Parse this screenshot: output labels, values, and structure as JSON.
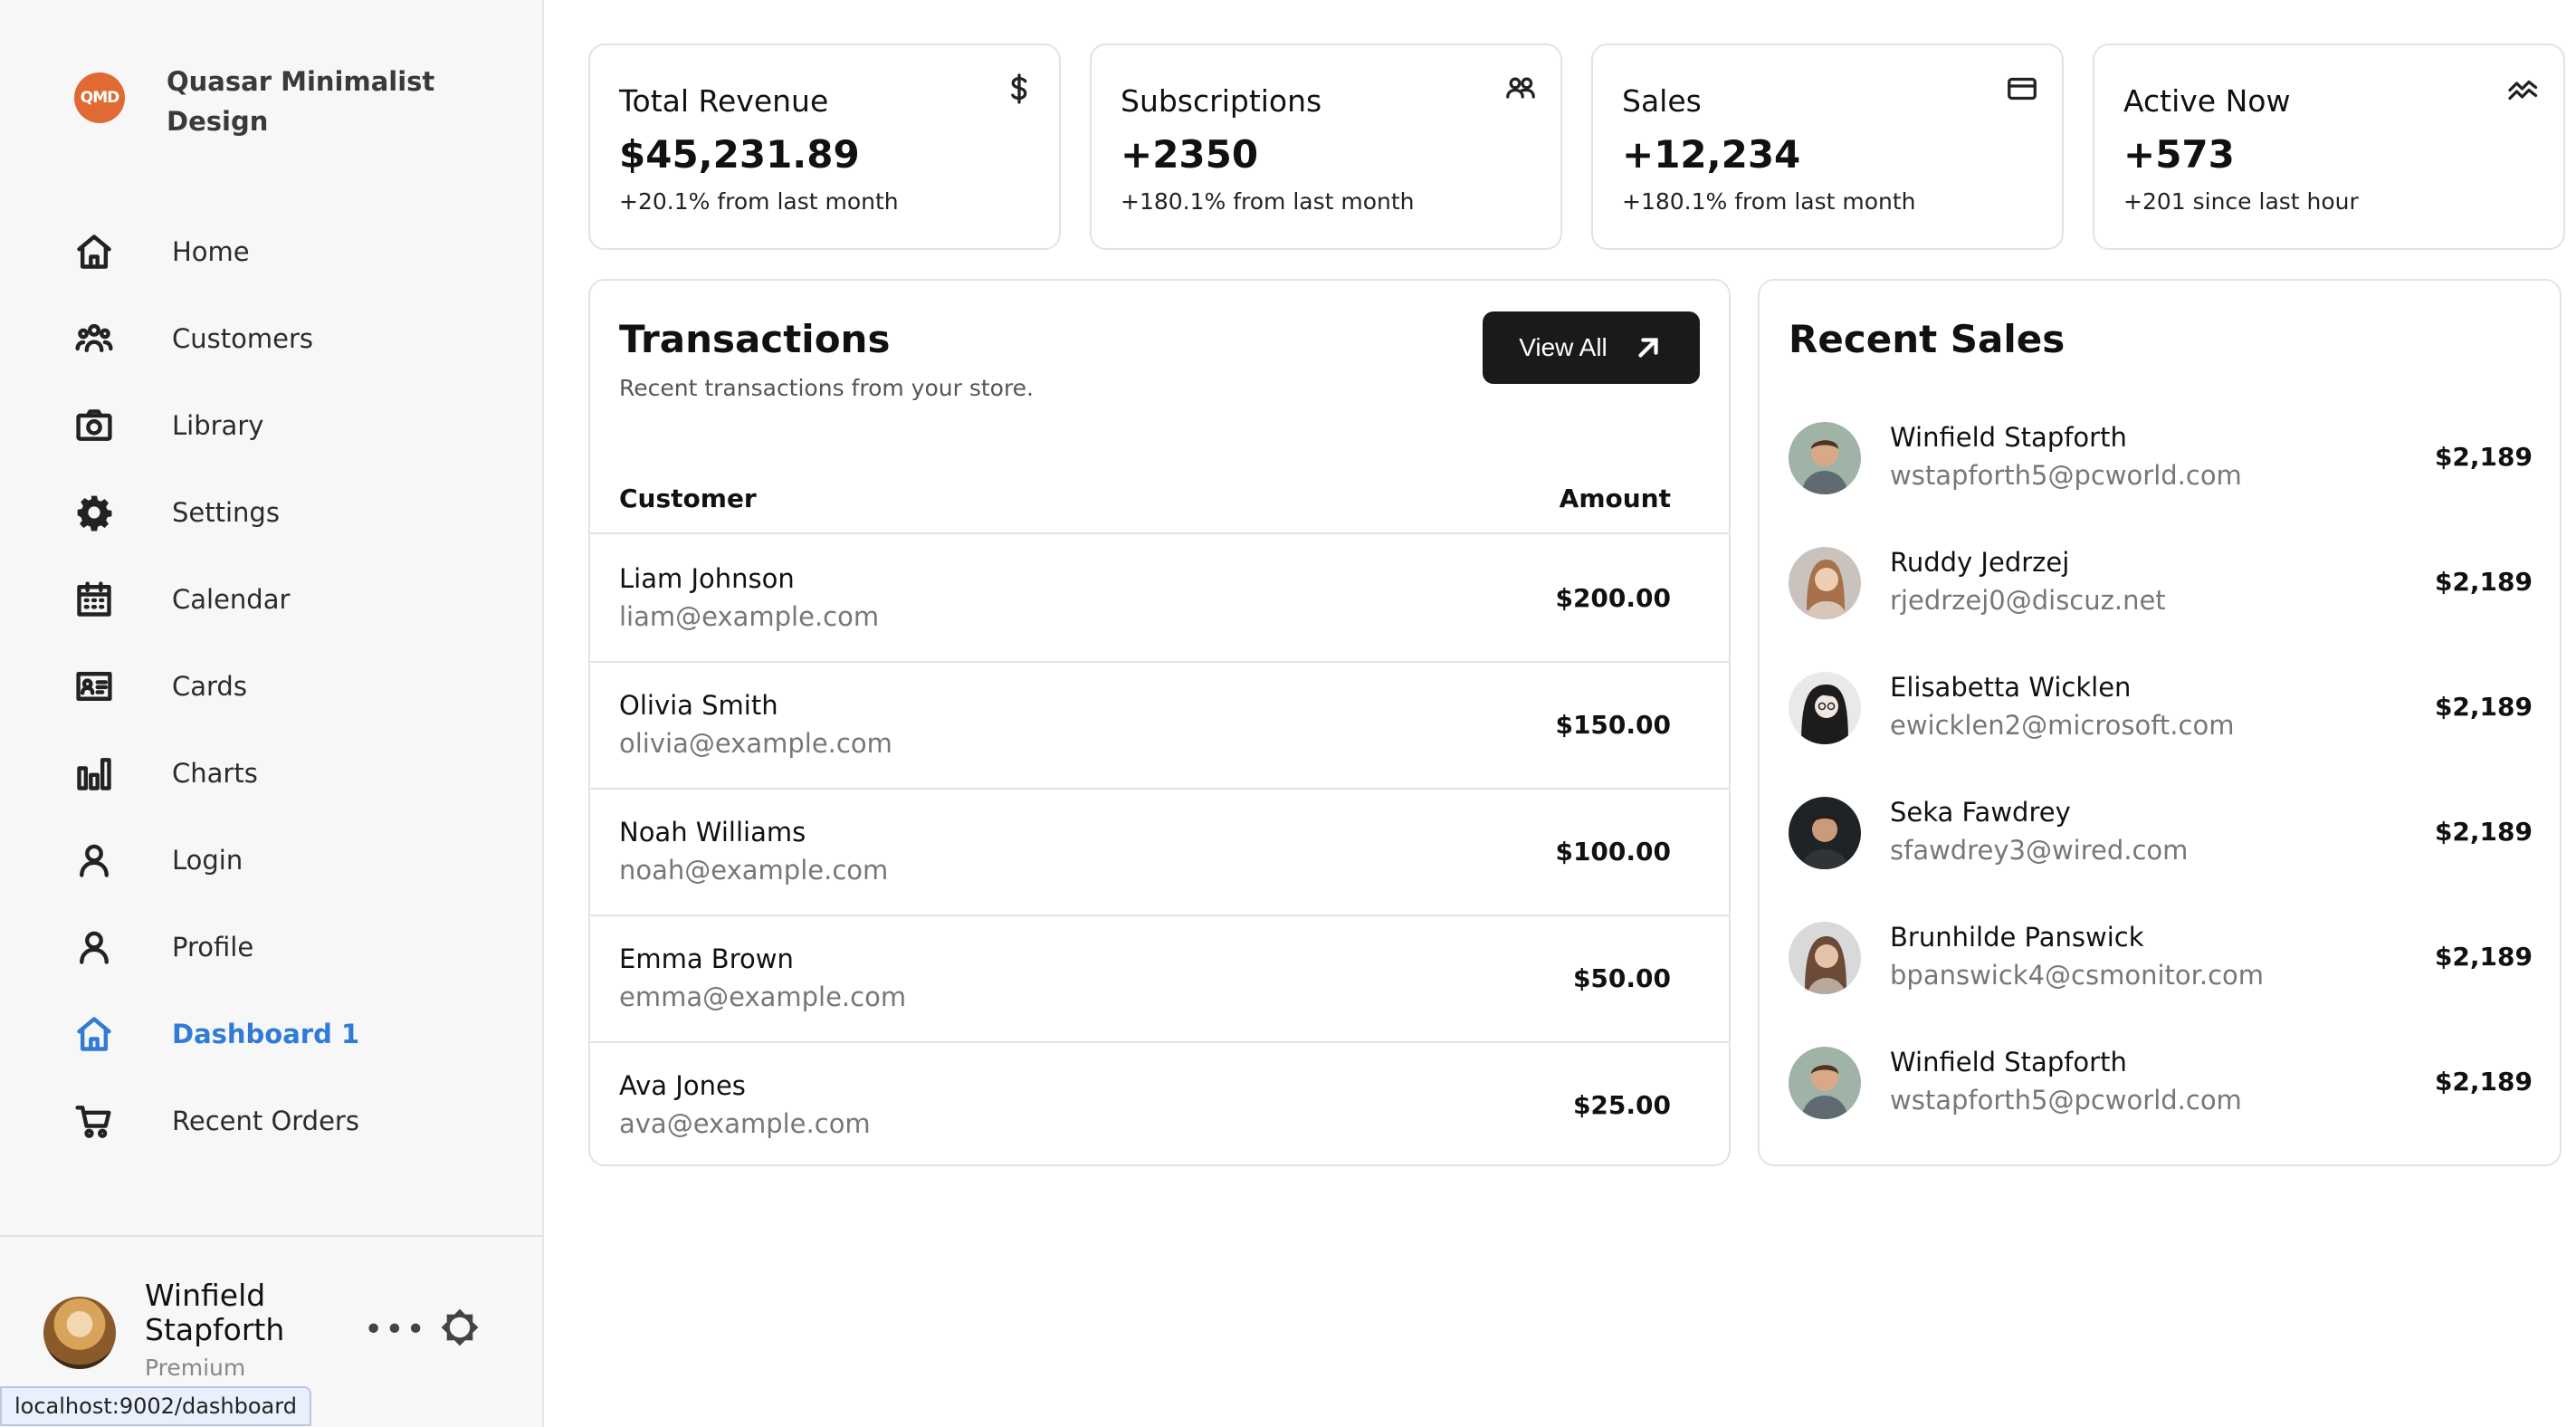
{
  "brand": {
    "logo_text": "QMD",
    "name": "Quasar Minimalist Design"
  },
  "sidebar": {
    "items": [
      {
        "label": "Home",
        "icon": "home-icon"
      },
      {
        "label": "Customers",
        "icon": "users-icon"
      },
      {
        "label": "Library",
        "icon": "camera-icon"
      },
      {
        "label": "Settings",
        "icon": "gear-icon"
      },
      {
        "label": "Calendar",
        "icon": "calendar-icon"
      },
      {
        "label": "Cards",
        "icon": "id-card-icon"
      },
      {
        "label": "Charts",
        "icon": "bar-chart-icon"
      },
      {
        "label": "Login",
        "icon": "person-icon"
      },
      {
        "label": "Profile",
        "icon": "person-icon"
      },
      {
        "label": "Dashboard 1",
        "icon": "home-icon",
        "active": true
      },
      {
        "label": "Recent Orders",
        "icon": "cart-icon"
      }
    ],
    "footer": {
      "user_name": "Winfield Stapforth",
      "user_plan": "Premium",
      "more_label": "•••"
    },
    "status_url": "localhost:9002/dashboard"
  },
  "stats": [
    {
      "title": "Total Revenue",
      "value": "$45,231.89",
      "sub": "+20.1% from last month",
      "icon": "dollar-icon"
    },
    {
      "title": "Subscriptions",
      "value": "+2350",
      "sub": "+180.1% from last month",
      "icon": "users-icon"
    },
    {
      "title": "Sales",
      "value": "+12,234",
      "sub": "+180.1% from last month",
      "icon": "credit-card-icon"
    },
    {
      "title": "Active Now",
      "value": "+573",
      "sub": "+201 since last hour",
      "icon": "activity-icon"
    }
  ],
  "transactions": {
    "title": "Transactions",
    "subtitle": "Recent transactions from your store.",
    "view_all_label": "View All",
    "columns": {
      "customer": "Customer",
      "amount": "Amount"
    },
    "rows": [
      {
        "name": "Liam Johnson",
        "email": "liam@example.com",
        "amount": "$200.00"
      },
      {
        "name": "Olivia Smith",
        "email": "olivia@example.com",
        "amount": "$150.00"
      },
      {
        "name": "Noah Williams",
        "email": "noah@example.com",
        "amount": "$100.00"
      },
      {
        "name": "Emma Brown",
        "email": "emma@example.com",
        "amount": "$50.00"
      },
      {
        "name": "Ava Jones",
        "email": "ava@example.com",
        "amount": "$25.00"
      }
    ]
  },
  "recent_sales": {
    "title": "Recent Sales",
    "rows": [
      {
        "name": "Winfield Stapforth",
        "email": "wstapforth5@pcworld.com",
        "amount": "$2,189"
      },
      {
        "name": "Ruddy Jedrzej",
        "email": "rjedrzej0@discuz.net",
        "amount": "$2,189"
      },
      {
        "name": "Elisabetta Wicklen",
        "email": "ewicklen2@microsoft.com",
        "amount": "$2,189"
      },
      {
        "name": "Seka Fawdrey",
        "email": "sfawdrey3@wired.com",
        "amount": "$2,189"
      },
      {
        "name": "Brunhilde Panswick",
        "email": "bpanswick4@csmonitor.com",
        "amount": "$2,189"
      },
      {
        "name": "Winfield Stapforth",
        "email": "wstapforth5@pcworld.com",
        "amount": "$2,189"
      }
    ]
  },
  "colors": {
    "accent": "#2f7bd6",
    "brand": "#e06a32",
    "button_dark": "#1a1a1a"
  }
}
